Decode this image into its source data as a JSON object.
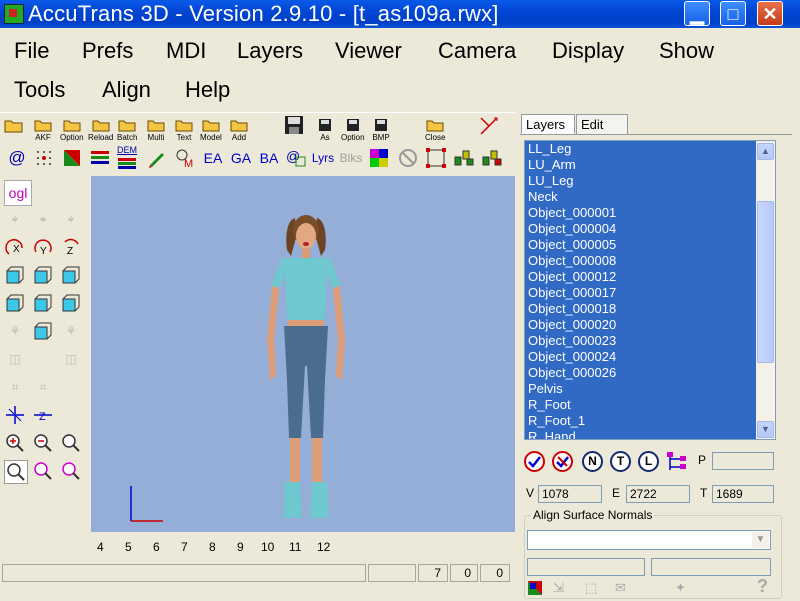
{
  "window": {
    "title": "AccuTrans 3D - Version 2.9.10 - [t_as109a.rwx]",
    "minimize_glyph": "▁",
    "maximize_glyph": "□",
    "close_glyph": "✕"
  },
  "menu": {
    "row1": [
      "File",
      "Prefs",
      "MDI",
      "Layers",
      "Viewer",
      "Camera",
      "Display",
      "Show"
    ],
    "row2": [
      "Tools",
      "Align",
      "Help"
    ]
  },
  "toolbar": {
    "row1_labels": [
      "AKF",
      "Option",
      "Reload",
      "Batch",
      "Multi",
      "Text",
      "Model",
      "Add",
      "As",
      "Option",
      "BMP",
      "Close"
    ],
    "row2_labels": [
      "@",
      "DEM",
      "EA",
      "GA",
      "BA",
      "Lyrs",
      "Blks"
    ]
  },
  "left_tools": {
    "ogl_label": "ogl",
    "axis_labels": [
      "X",
      "Y",
      "Z"
    ]
  },
  "viewport": {
    "background": "#95aed8",
    "ruler": [
      "4",
      "5",
      "6",
      "7",
      "8",
      "9",
      "10",
      "11",
      "12"
    ]
  },
  "status_bar": {
    "fields": [
      "7",
      "0",
      "0"
    ]
  },
  "right_panel": {
    "tabs": [
      "Layers",
      "Edit"
    ],
    "layers": [
      "LL_Leg",
      "LU_Arm",
      "LU_Leg",
      "Neck",
      "Object_000001",
      "Object_000004",
      "Object_000005",
      "Object_000008",
      "Object_000012",
      "Object_000017",
      "Object_000018",
      "Object_000020",
      "Object_000023",
      "Object_000024",
      "Object_000026",
      "Pelvis",
      "R_Foot",
      "R_Foot_1",
      "R_Hand"
    ],
    "action_buttons": [
      "N",
      "T",
      "L"
    ],
    "p_label": "P",
    "p_value": "",
    "v_label": "V",
    "v_value": "1078",
    "e_label": "E",
    "e_value": "2722",
    "t_label": "T",
    "t_value": "1689",
    "align_title": "Align Surface Normals",
    "help_glyph": "?",
    "selection_color": "#316ac5"
  }
}
